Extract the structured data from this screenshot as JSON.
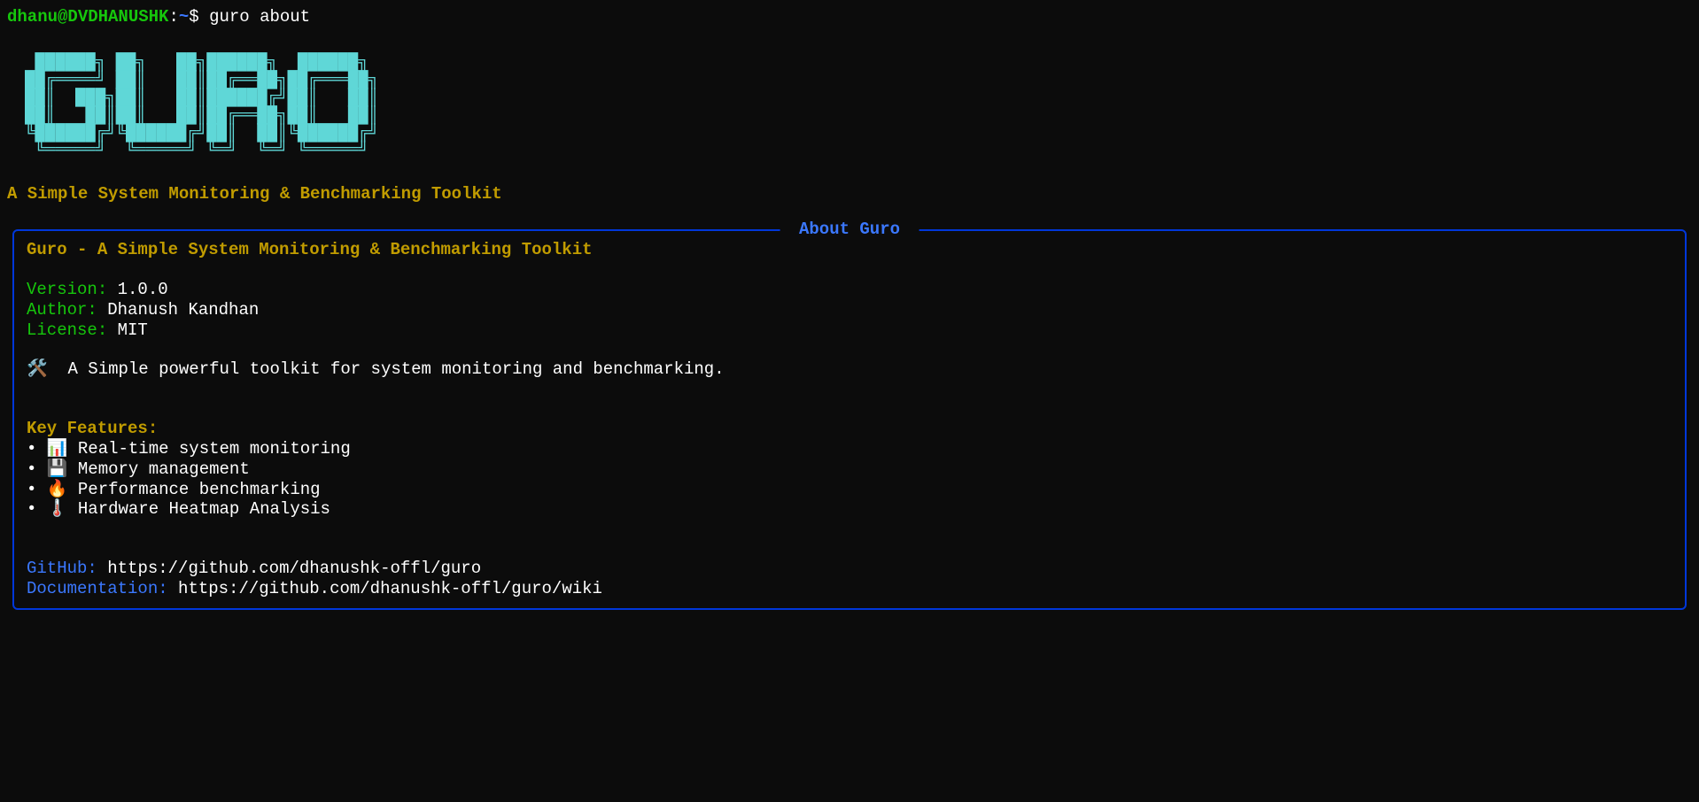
{
  "prompt": {
    "user_host": "dhanu@DVDHANUSHK",
    "path": "~",
    "symbol": "$",
    "command": "guro about"
  },
  "logo_ascii": " ██████╗ ██╗   ██╗██████╗  ██████╗ \n██╔════╝ ██║   ██║██╔══██╗██╔═══██╗\n██║  ███╗██║   ██║██████╔╝██║   ██║\n██║   ██║██║   ██║██╔══██╗██║   ██║\n╚██████╔╝╚██████╔╝██║  ██║╚██████╔╝\n ╚═════╝  ╚═════╝ ╚═╝  ╚═╝ ╚═════╝ ",
  "tagline": "A Simple System Monitoring & Benchmarking Toolkit",
  "panel": {
    "title": "About Guro",
    "heading": "Guro - A Simple System Monitoring & Benchmarking Toolkit",
    "meta": {
      "version_label": "Version:",
      "version_value": "1.0.0",
      "author_label": "Author:",
      "author_value": "Dhanush Kandhan",
      "license_label": "License:",
      "license_value": "MIT"
    },
    "description_icon": "🛠️",
    "description": "A Simple powerful toolkit for system monitoring and benchmarking.",
    "features_title": "Key Features:",
    "features": [
      {
        "icon": "📊",
        "text": "Real-time system monitoring"
      },
      {
        "icon": "💾",
        "text": "Memory management"
      },
      {
        "icon": "🔥",
        "text": "Performance benchmarking"
      },
      {
        "icon": "🌡️",
        "text": "Hardware Heatmap Analysis"
      }
    ],
    "links": {
      "github_label": "GitHub:",
      "github_url": "https://github.com/dhanushk-offl/guro",
      "docs_label": "Documentation:",
      "docs_url": "https://github.com/dhanushk-offl/guro/wiki"
    }
  }
}
